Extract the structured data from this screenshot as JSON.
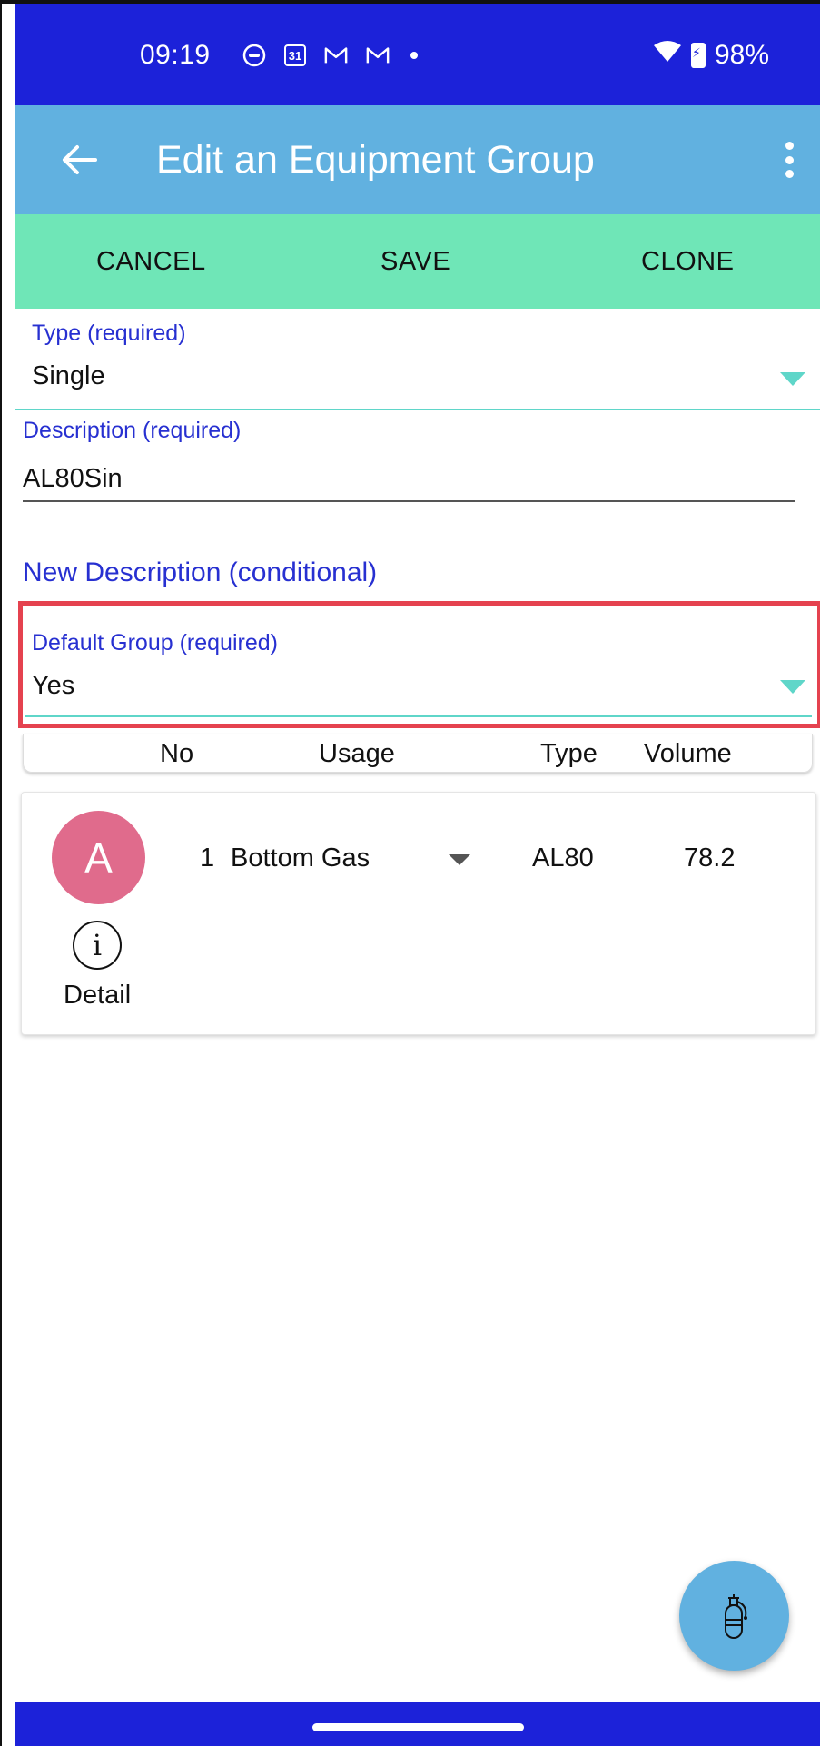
{
  "status_bar": {
    "time": "09:19",
    "battery": "98%",
    "icons": [
      "face-icon",
      "calendar-icon",
      "gmail-icon",
      "gmail-icon",
      "dot-icon",
      "wifi-icon",
      "battery-charging-icon"
    ],
    "calendar_day": "31"
  },
  "app_bar": {
    "title": "Edit an Equipment Group"
  },
  "actions": {
    "cancel": "CANCEL",
    "save": "SAVE",
    "clone": "CLONE"
  },
  "form": {
    "type": {
      "label": "Type (required)",
      "value": "Single"
    },
    "description": {
      "label": "Description (required)",
      "value": "AL80Sin"
    },
    "new_description": {
      "label": "New Description (conditional)"
    },
    "default_group": {
      "label": "Default Group (required)",
      "value": "Yes"
    }
  },
  "table": {
    "headers": {
      "no": "No",
      "usage": "Usage",
      "type": "Type",
      "volume": "Volume"
    },
    "rows": [
      {
        "avatar": "A",
        "detail": "Detail",
        "no": "1",
        "usage": "Bottom Gas",
        "type": "AL80",
        "volume": "78.2"
      }
    ]
  },
  "colors": {
    "status_bar": "#1c22d9",
    "app_bar": "#61b1e0",
    "action_bar": "#6fe6b7",
    "label": "#2730d1",
    "accent_teal": "#5fd6c9",
    "avatar": "#e06b8c",
    "highlight": "#e5424f"
  }
}
